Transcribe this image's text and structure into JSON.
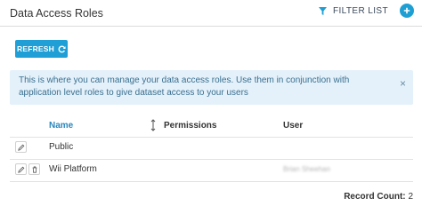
{
  "header": {
    "title": "Data Access Roles",
    "filter_label": "FILTER LIST"
  },
  "toolbar": {
    "refresh_label": "REFRESH"
  },
  "info": {
    "message": "This is where you can manage your data access roles. Use them in conjunction with application level roles to give dataset access to your users",
    "close_glyph": "×"
  },
  "table": {
    "columns": {
      "name": "Name",
      "permissions": "Permissions",
      "user": "User"
    },
    "rows": [
      {
        "name": "Public",
        "permissions": "",
        "user": ""
      },
      {
        "name": "Wii Platform",
        "permissions": "",
        "user": "Brian Sheehan"
      }
    ]
  },
  "footer": {
    "record_count_label": "Record Count:",
    "record_count_value": "2"
  },
  "colors": {
    "accent": "#1f9fd5",
    "info_bg": "#e4f1fa",
    "info_text": "#3a6f90"
  }
}
